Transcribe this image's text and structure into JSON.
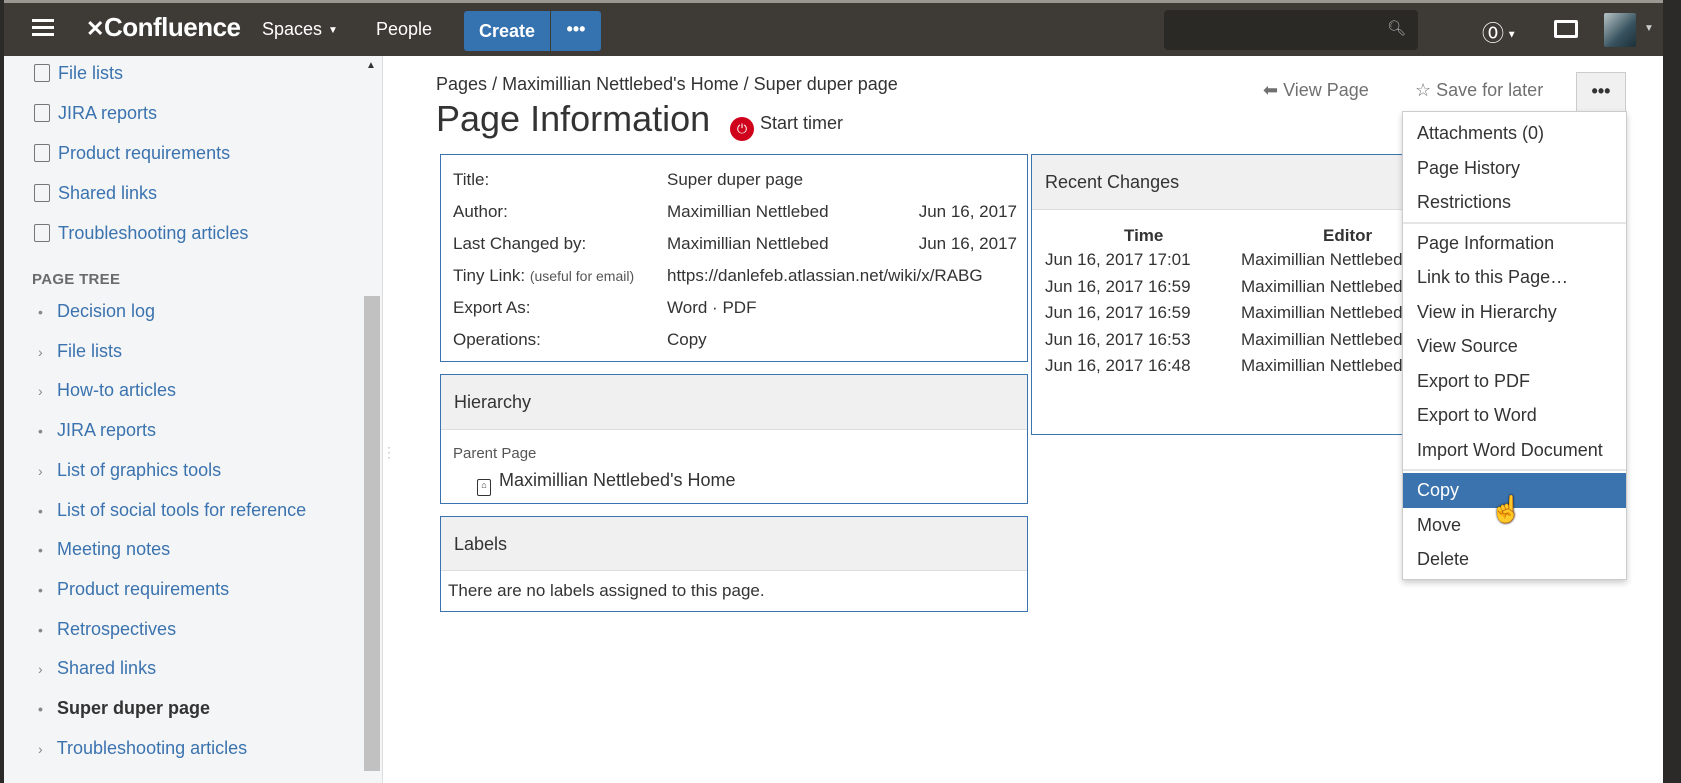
{
  "header": {
    "logo": "Confluence",
    "spaces": "Spaces",
    "people": "People",
    "create": "Create",
    "create_more": "•••",
    "search_placeholder": ""
  },
  "sidebar": {
    "shortcuts": [
      {
        "label": "File lists",
        "icon": "folder-icon"
      },
      {
        "label": "JIRA reports",
        "icon": "jira-icon"
      },
      {
        "label": "Product requirements",
        "icon": "requirements-icon"
      },
      {
        "label": "Shared links",
        "icon": "link-icon"
      },
      {
        "label": "Troubleshooting articles",
        "icon": "troubleshoot-icon"
      }
    ],
    "page_tree_title": "PAGE TREE",
    "tree": [
      {
        "label": "Decision log",
        "bullet": "•"
      },
      {
        "label": "File lists",
        "bullet": "›"
      },
      {
        "label": "How-to articles",
        "bullet": "›"
      },
      {
        "label": "JIRA reports",
        "bullet": "•"
      },
      {
        "label": "List of graphics tools",
        "bullet": "›"
      },
      {
        "label": "List of social tools for reference",
        "bullet": "•"
      },
      {
        "label": "Meeting notes",
        "bullet": "•"
      },
      {
        "label": "Product requirements",
        "bullet": "•"
      },
      {
        "label": "Retrospectives",
        "bullet": "•"
      },
      {
        "label": "Shared links",
        "bullet": "›"
      },
      {
        "label": "Super duper page",
        "bullet": "•",
        "current": true
      },
      {
        "label": "Troubleshooting articles",
        "bullet": "›"
      }
    ]
  },
  "breadcrumb": [
    "Pages",
    "Maximillian Nettlebed's Home",
    "Super duper page"
  ],
  "breadcrumb_sep": "/",
  "page_title": "Page Information",
  "start_timer": "Start timer",
  "actions": {
    "view_page": "View Page",
    "save_for_later": "Save for later",
    "more": "•••"
  },
  "info": {
    "title_label": "Title:",
    "title_value": "Super duper page",
    "author_label": "Author:",
    "author_value": "Maximillian Nettlebed",
    "author_date": "Jun 16, 2017",
    "changed_label": "Last Changed by:",
    "changed_value": "Maximillian Nettlebed",
    "changed_date": "Jun 16, 2017",
    "tiny_label": "Tiny Link:",
    "tiny_hint": "(useful for email)",
    "tiny_value": "https://danlefeb.atlassian.net/wiki/x/RABG",
    "export_label": "Export As:",
    "export_word": "Word",
    "export_sep": "·",
    "export_pdf": "PDF",
    "ops_label": "Operations:",
    "ops_copy": "Copy"
  },
  "hierarchy": {
    "title": "Hierarchy",
    "parent_label": "Parent Page",
    "parent": "Maximillian Nettlebed's Home"
  },
  "labels": {
    "title": "Labels",
    "empty": "There are no labels assigned to this page."
  },
  "recent": {
    "title": "Recent Changes",
    "columns": [
      "Time",
      "Editor"
    ],
    "rows": [
      {
        "time": "Jun 16, 2017 17:01",
        "editor": "Maximillian Nettlebed"
      },
      {
        "time": "Jun 16, 2017 16:59",
        "editor": "Maximillian Nettlebed"
      },
      {
        "time": "Jun 16, 2017 16:59",
        "editor": "Maximillian Nettlebed"
      },
      {
        "time": "Jun 16, 2017 16:53",
        "editor": "Maximillian Nettlebed"
      },
      {
        "time": "Jun 16, 2017 16:48",
        "editor": "Maximillian Nettlebed"
      }
    ]
  },
  "menu": {
    "groups": [
      [
        "Attachments (0)",
        "Page History",
        "Restrictions"
      ],
      [
        "Page Information",
        "Link to this Page…",
        "View in Hierarchy",
        "View Source",
        "Export to PDF",
        "Export to Word",
        "Import Word Document"
      ],
      [
        "Copy",
        "Move",
        "Delete"
      ]
    ],
    "selected": "Copy"
  },
  "colors": {
    "header": "#3e3a35",
    "accent": "#3572b0",
    "link": "#3b73af",
    "selected": "#3b73af"
  }
}
